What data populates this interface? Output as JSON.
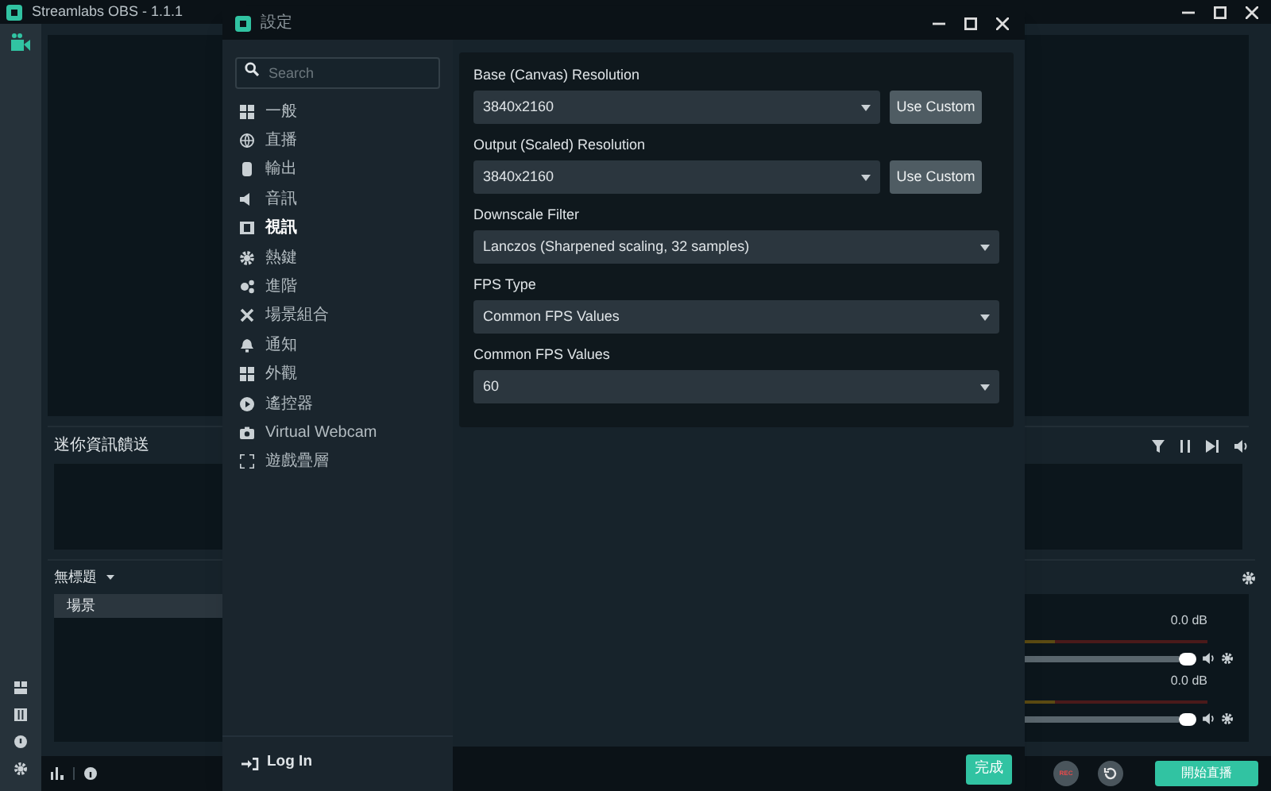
{
  "app": {
    "title": "Streamlabs OBS - 1.1.1"
  },
  "mini_feed": {
    "title": "迷你資訊饋送"
  },
  "scene_collection": {
    "name": "無標題",
    "scenes": [
      {
        "label": "場景",
        "selected": true
      }
    ]
  },
  "mixer": {
    "channels": [
      {
        "reading": "0.0 dB",
        "level": 1.0
      },
      {
        "reading": "0.0 dB",
        "level": 1.0
      }
    ]
  },
  "footer": {
    "rec_label": "REC",
    "go_live": "開始直播"
  },
  "settings": {
    "title": "設定",
    "search": {
      "placeholder": "Search"
    },
    "nav": [
      {
        "label": "一般",
        "selected": false
      },
      {
        "label": "直播",
        "selected": false
      },
      {
        "label": "輸出",
        "selected": false
      },
      {
        "label": "音訊",
        "selected": false
      },
      {
        "label": "視訊",
        "selected": true
      },
      {
        "label": "熱鍵",
        "selected": false
      },
      {
        "label": "進階",
        "selected": false
      },
      {
        "label": "場景組合",
        "selected": false
      },
      {
        "label": "通知",
        "selected": false
      },
      {
        "label": "外觀",
        "selected": false
      },
      {
        "label": "遙控器",
        "selected": false
      },
      {
        "label": "Virtual Webcam",
        "selected": false
      },
      {
        "label": "遊戲疊層",
        "selected": false
      }
    ],
    "login": "Log In",
    "fields": [
      {
        "kind": "select_button",
        "label": "Base (Canvas) Resolution",
        "value": "3840x2160",
        "button": "Use Custom"
      },
      {
        "kind": "select_button",
        "label": "Output (Scaled) Resolution",
        "value": "3840x2160",
        "button": "Use Custom"
      },
      {
        "kind": "select",
        "label": "Downscale Filter",
        "value": "Lanczos (Sharpened scaling, 32 samples)"
      },
      {
        "kind": "select",
        "label": "FPS Type",
        "value": "Common FPS Values"
      },
      {
        "kind": "select",
        "label": "Common FPS Values",
        "value": "60"
      }
    ],
    "done": "完成"
  }
}
